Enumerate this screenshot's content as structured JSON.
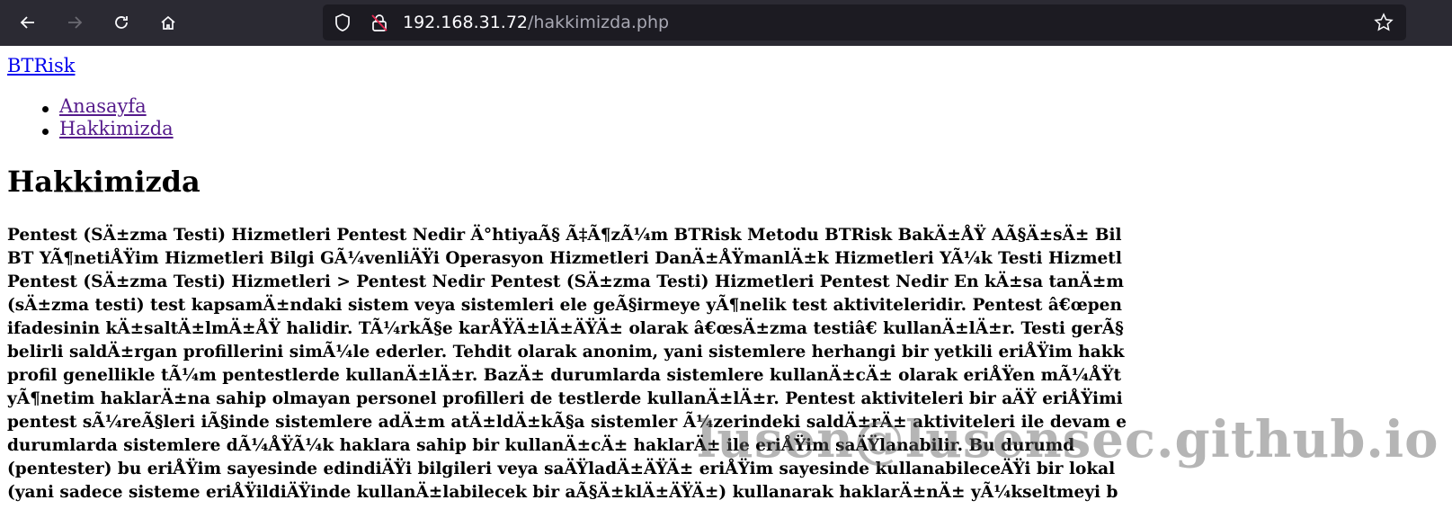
{
  "browser": {
    "url_host": "192.168.31.72",
    "url_path": "/hakkimizda.php",
    "icons": [
      "back-icon",
      "forward-icon",
      "reload-icon",
      "home-icon",
      "shield-icon",
      "insecure-lock-icon",
      "bookmark-star-icon"
    ]
  },
  "page": {
    "site_link": "BTRisk",
    "menu": [
      {
        "label": "Anasayfa"
      },
      {
        "label": "Hakkimizda"
      }
    ],
    "title": "Hakkimizda",
    "lines": [
      "Pentest (SÄ±zma Testi) Hizmetleri Pentest Nedir Ä°htiyaÃ§ Ã‡Ã¶zÃ¼m BTRisk Metodu BTRisk BakÄ±ÅŸ AÃ§Ä±sÄ± Bil",
      "BT YÃ¶netiÅŸim Hizmetleri Bilgi GÃ¼venliÄŸi Operasyon Hizmetleri DanÄ±ÅŸmanlÄ±k Hizmetleri YÃ¼k Testi Hizmetl",
      "Pentest (SÄ±zma Testi) Hizmetleri > Pentest Nedir Pentest (SÄ±zma Testi) Hizmetleri Pentest Nedir En kÄ±sa tanÄ±m",
      "(sÄ±zma testi) test kapsamÄ±ndaki sistem veya sistemleri ele geÃ§irmeye yÃ¶nelik test aktiviteleridir. Pentest â€œpen",
      "ifadesinin kÄ±saltÄ±lmÄ±ÅŸ halidir. TÃ¼rkÃ§e karÅŸÄ±lÄ±ÄŸÄ± olarak â€œsÄ±zma testiâ€ kullanÄ±lÄ±r. Testi gerÃ§",
      "belirli saldÄ±rgan profillerini simÃ¼le ederler. Tehdit olarak anonim, yani sistemlere herhangi bir yetkili eriÅŸim hakk",
      "profil genellikle tÃ¼m pentestlerde kullanÄ±lÄ±r. BazÄ± durumlarda sistemlere kullanÄ±cÄ± olarak eriÅŸen mÃ¼ÅŸt",
      "yÃ¶netim haklarÄ±na sahip olmayan personel profilleri de testlerde kullanÄ±lÄ±r. Pentest aktiviteleri bir aÄŸ eriÅŸimi",
      "pentest sÃ¼reÃ§leri iÃ§inde sistemlere adÄ±m atÄ±ldÄ±kÃ§a sistemler Ã¼zerindeki saldÄ±rÄ± aktiviteleri ile devam e",
      "durumlarda sistemlere dÃ¼ÅŸÃ¼k haklara sahip bir kullanÄ±cÄ± haklarÄ± ile eriÅŸim saÄŸlanabilir. Bu durumd",
      "(pentester) bu eriÅŸim sayesinde edindiÄŸi bilgileri veya saÄŸladÄ±ÄŸÄ± eriÅŸim sayesinde kullanabileceÄŸi bir lokal",
      "(yani sadece sisteme eriÅŸildiÄŸinde kullanÄ±labilecek bir aÃ§Ä±klÄ±ÄŸÄ±) kullanarak haklarÄ±nÄ± yÃ¼kseltmeyi b"
    ],
    "watermark": "lusen@lusensec.github.io"
  }
}
